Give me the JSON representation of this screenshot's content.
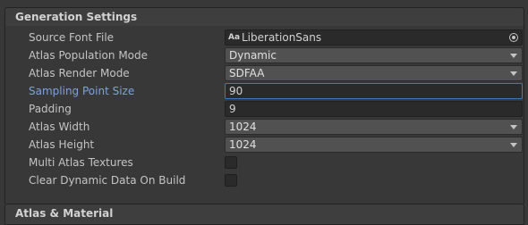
{
  "sections": {
    "generation_settings": "Generation Settings",
    "atlas_material": "Atlas & Material"
  },
  "rows": {
    "source_font_file": {
      "label": "Source Font File",
      "icon": "Aa",
      "value": "LiberationSans"
    },
    "atlas_population_mode": {
      "label": "Atlas Population Mode",
      "value": "Dynamic"
    },
    "atlas_render_mode": {
      "label": "Atlas Render Mode",
      "value": "SDFAA"
    },
    "sampling_point_size": {
      "label": "Sampling Point Size",
      "value": "90"
    },
    "padding": {
      "label": "Padding",
      "value": "9"
    },
    "atlas_width": {
      "label": "Atlas Width",
      "value": "1024"
    },
    "atlas_height": {
      "label": "Atlas Height",
      "value": "1024"
    },
    "multi_atlas_textures": {
      "label": "Multi Atlas Textures",
      "checked": false
    },
    "clear_dynamic_data": {
      "label": "Clear Dynamic Data On Build",
      "checked": false
    }
  },
  "colors": {
    "background": "#383838",
    "focus_border": "#3a79bb",
    "active_label": "#7ea1df"
  }
}
